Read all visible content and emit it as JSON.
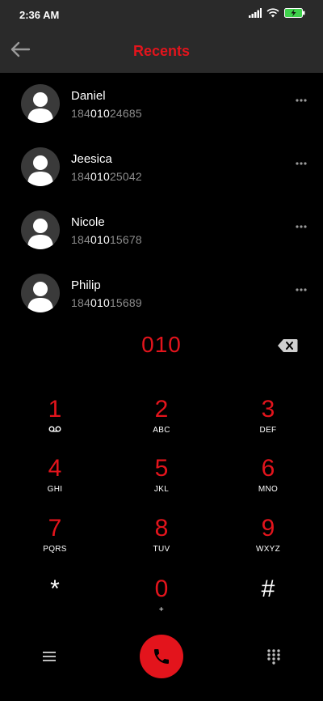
{
  "status_bar": {
    "time": "2:36 AM"
  },
  "header": {
    "title": "Recents"
  },
  "contacts": [
    {
      "name": "Daniel",
      "number_prefix": "184",
      "number_match": "010",
      "number_suffix": "24685"
    },
    {
      "name": "Jeesica",
      "number_prefix": "184",
      "number_match": "010",
      "number_suffix": "25042"
    },
    {
      "name": "Nicole",
      "number_prefix": "184",
      "number_match": "010",
      "number_suffix": "15678"
    },
    {
      "name": "Philip",
      "number_prefix": "184",
      "number_match": "010",
      "number_suffix": "15689"
    }
  ],
  "dial_input": {
    "value": "010"
  },
  "keypad": [
    {
      "digit": "1",
      "letters": "",
      "icon": "voicemail-icon"
    },
    {
      "digit": "2",
      "letters": "ABC"
    },
    {
      "digit": "3",
      "letters": "DEF"
    },
    {
      "digit": "4",
      "letters": "GHI"
    },
    {
      "digit": "5",
      "letters": "JKL"
    },
    {
      "digit": "6",
      "letters": "MNO"
    },
    {
      "digit": "7",
      "letters": "PQRS"
    },
    {
      "digit": "8",
      "letters": "TUV"
    },
    {
      "digit": "9",
      "letters": "WXYZ"
    },
    {
      "digit": "*",
      "letters": ""
    },
    {
      "digit": "0",
      "letters": "+"
    },
    {
      "digit": "#",
      "letters": ""
    }
  ],
  "colors": {
    "accent": "#e3141c",
    "background": "#000000",
    "bar": "#2a2a2a",
    "muted_text": "#8c8c8c"
  }
}
